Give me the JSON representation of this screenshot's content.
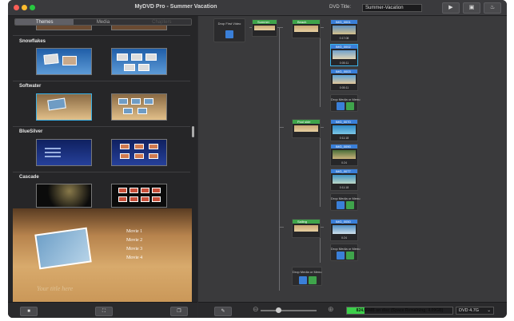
{
  "window": {
    "title": "MyDVD Pro - Summer Vacation",
    "dvd_title_label": "DVD Title:",
    "dvd_title_value": "Summer-Vacation",
    "toolbar": {
      "play_icon": "play-icon",
      "save_icon": "save-icon",
      "burn_icon": "burn-flame-icon"
    }
  },
  "left_panel": {
    "tabs": [
      {
        "label": "Themes",
        "active": true
      },
      {
        "label": "Media",
        "active": false
      },
      {
        "label": "Chapters",
        "active": false
      }
    ],
    "themes": [
      {
        "name": "Snowflakes"
      },
      {
        "name": "Softwater"
      },
      {
        "name": "BlueSilver"
      },
      {
        "name": "Cascade"
      }
    ],
    "preview": {
      "menu_items": [
        "Movie 1",
        "Movie 2",
        "Movie 3",
        "Movie 4"
      ],
      "title_placeholder": "Your title here"
    },
    "bottom_buttons": [
      "stop-icon",
      "fit-icon",
      "slides-icon"
    ]
  },
  "canvas": {
    "drop_first_video": "Drop First Video",
    "root_menu": {
      "label": "Summer"
    },
    "submenus": [
      {
        "label": "Beach",
        "clips": [
          {
            "name": "IMG_0001",
            "duration": "0:17:08"
          },
          {
            "name": "IMG_0002",
            "duration": "0:05:11"
          },
          {
            "name": "IMG_0003",
            "duration": "0:05:11"
          }
        ]
      },
      {
        "label": "Pool side",
        "clips": [
          {
            "name": "IMG_0070",
            "duration": "0:11:18"
          },
          {
            "name": "IMG_0090",
            "duration": "0:24"
          },
          {
            "name": "IMG_0077",
            "duration": "0:11:18"
          }
        ]
      },
      {
        "label": "Sailing",
        "clips": [
          {
            "name": "IMG_0050",
            "duration": "0:24"
          }
        ]
      }
    ],
    "drop_media_label": "Drop Media or Menu"
  },
  "status": {
    "capacity_text": "824.56MB on disc (Space Remaining: 4.09GB)",
    "capacity_fraction": 0.17,
    "disc_type": "DVD 4.7G"
  },
  "colors": {
    "accent_green": "#3fa44b",
    "clip_blue": "#3a7fd8",
    "selection_blue": "#3ab2e8",
    "capacity_green": "#3ccf4a"
  }
}
